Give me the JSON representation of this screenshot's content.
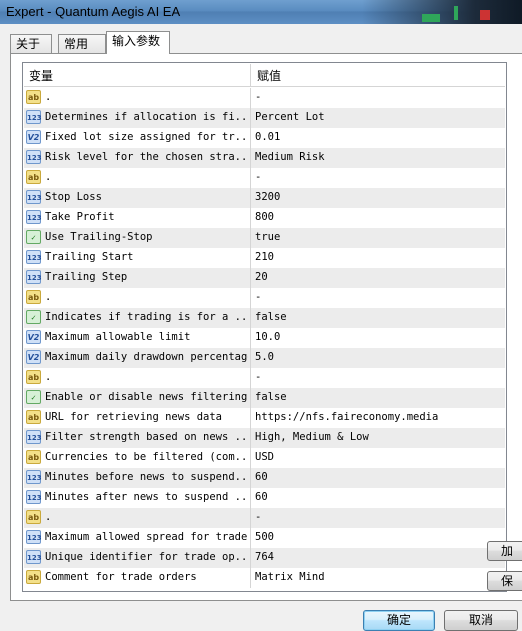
{
  "window": {
    "title": "Expert - Quantum Aegis AI EA"
  },
  "tabs": [
    {
      "label": "关于"
    },
    {
      "label": "常用"
    },
    {
      "label": "输入参数"
    }
  ],
  "table": {
    "columns": [
      "变量",
      "赋值"
    ],
    "rows": [
      {
        "icon": "ab",
        "name": ".",
        "value": "-"
      },
      {
        "icon": "123",
        "name": "Determines if allocation is fi...",
        "value": "Percent Lot"
      },
      {
        "icon": "V2",
        "name": "Fixed lot size assigned for tr...",
        "value": "0.01"
      },
      {
        "icon": "123",
        "name": "Risk level for the chosen stra...",
        "value": "Medium Risk"
      },
      {
        "icon": "ab",
        "name": ".",
        "value": "-"
      },
      {
        "icon": "123",
        "name": "Stop Loss",
        "value": "3200"
      },
      {
        "icon": "123",
        "name": "Take Profit",
        "value": "800"
      },
      {
        "icon": "bool",
        "name": "Use Trailing-Stop",
        "value": "true"
      },
      {
        "icon": "123",
        "name": "Trailing Start",
        "value": "210"
      },
      {
        "icon": "123",
        "name": "Trailing Step",
        "value": "20"
      },
      {
        "icon": "ab",
        "name": ".",
        "value": "-"
      },
      {
        "icon": "bool",
        "name": "Indicates if trading is for a ...",
        "value": "false"
      },
      {
        "icon": "V2",
        "name": "Maximum allowable limit",
        "value": "10.0"
      },
      {
        "icon": "V2",
        "name": "Maximum daily drawdown percentage",
        "value": "5.0"
      },
      {
        "icon": "ab",
        "name": ".",
        "value": "-"
      },
      {
        "icon": "bool",
        "name": "Enable or disable news filtering",
        "value": "false"
      },
      {
        "icon": "ab",
        "name": "URL for retrieving news data",
        "value": "https://nfs.faireconomy.media"
      },
      {
        "icon": "123",
        "name": "Filter strength based on news ...",
        "value": "High, Medium & Low"
      },
      {
        "icon": "ab",
        "name": "Currencies to be filtered (com...",
        "value": "USD"
      },
      {
        "icon": "123",
        "name": "Minutes before news to suspend...",
        "value": "60"
      },
      {
        "icon": "123",
        "name": "Minutes after news to suspend ...",
        "value": "60"
      },
      {
        "icon": "ab",
        "name": ".",
        "value": "-"
      },
      {
        "icon": "123",
        "name": "Maximum allowed spread for trades",
        "value": "500"
      },
      {
        "icon": "123",
        "name": "Unique identifier for trade op...",
        "value": "764"
      },
      {
        "icon": "ab",
        "name": "Comment for trade orders",
        "value": "Matrix Mind"
      }
    ]
  },
  "side_buttons": [
    {
      "label": "加"
    },
    {
      "label": "保"
    }
  ],
  "footer": {
    "ok_label": "确定",
    "cancel_label": "取消"
  }
}
